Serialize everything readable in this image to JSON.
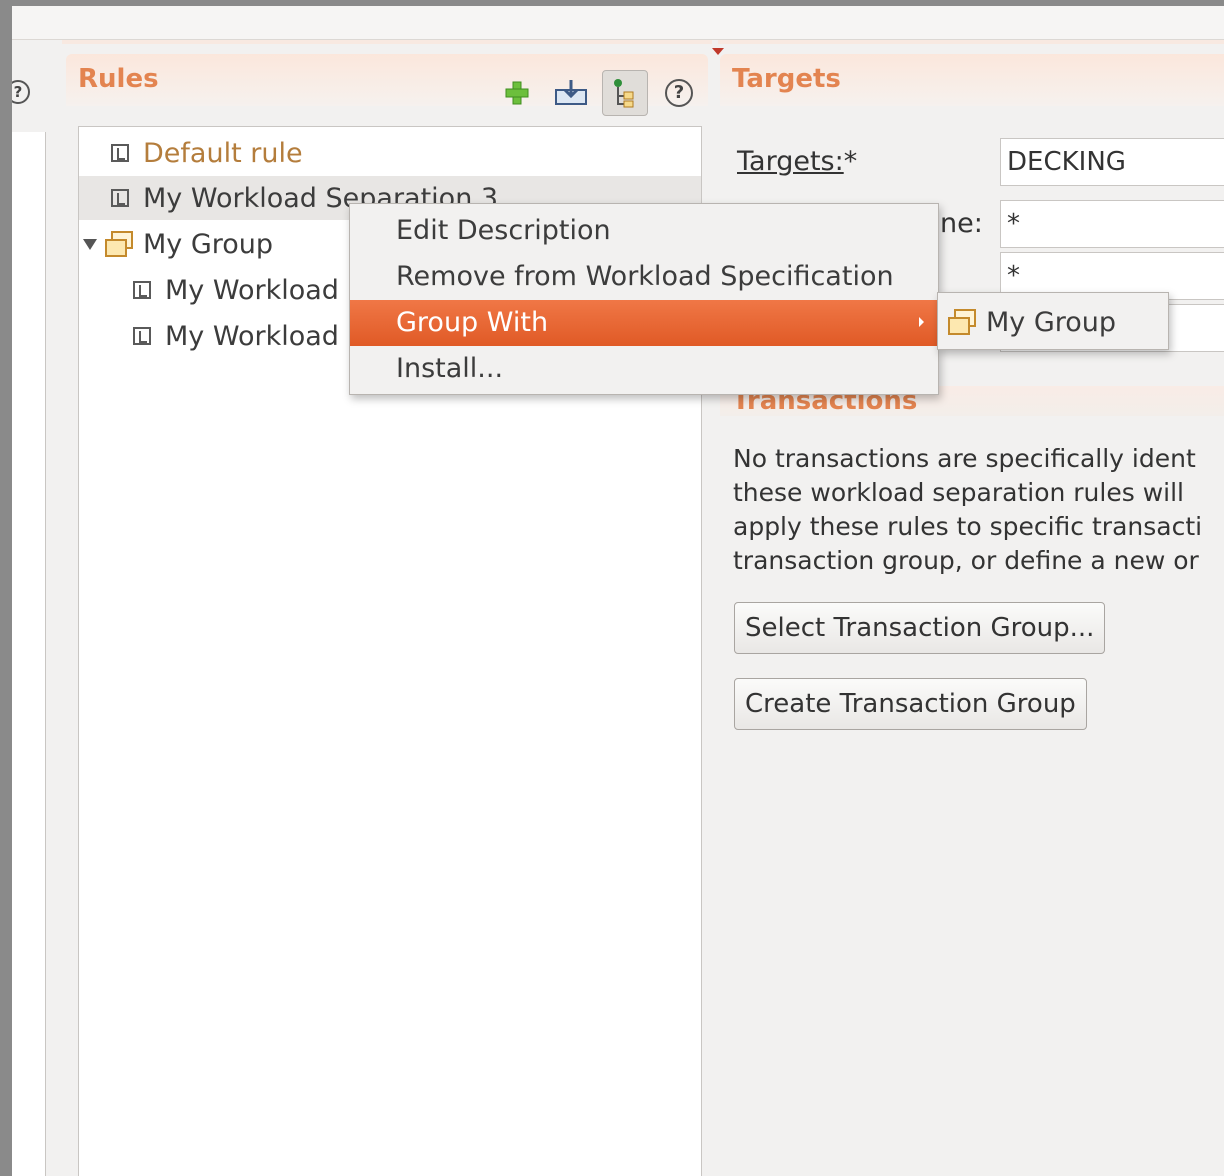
{
  "rules": {
    "title": "Rules",
    "toolbar": {
      "help": "?"
    },
    "tree": [
      {
        "label": "Default rule"
      },
      {
        "label": "My Workload Separation 3"
      },
      {
        "label": "My Group"
      },
      {
        "label": "My Workload"
      },
      {
        "label": "My Workload"
      }
    ]
  },
  "left_panel": {
    "help": "?"
  },
  "targets": {
    "title": "Targets",
    "fields": {
      "targets_label": "Targets:",
      "required_mark": "*",
      "targets_value": "DECKING",
      "name_label_partial": "ne:",
      "name_value": "*",
      "third_value": "*"
    },
    "transactions": {
      "title": "Transactions",
      "text_lines": [
        "No transactions are specifically ident",
        "these workload separation rules will",
        "apply these rules to specific transacti",
        "transaction group, or define a new or"
      ],
      "select_button": "Select Transaction Group...",
      "create_button": "Create Transaction Group"
    }
  },
  "context_menu": {
    "items": [
      {
        "label": "Edit Description"
      },
      {
        "label": "Remove from Workload Specification"
      },
      {
        "label": "Group With"
      },
      {
        "label": "Install..."
      }
    ],
    "submenu": {
      "label": "My Group"
    }
  },
  "colors": {
    "accent": "#e38450",
    "menu_highlight": "#e8642f",
    "folder": "#c48a2c"
  }
}
